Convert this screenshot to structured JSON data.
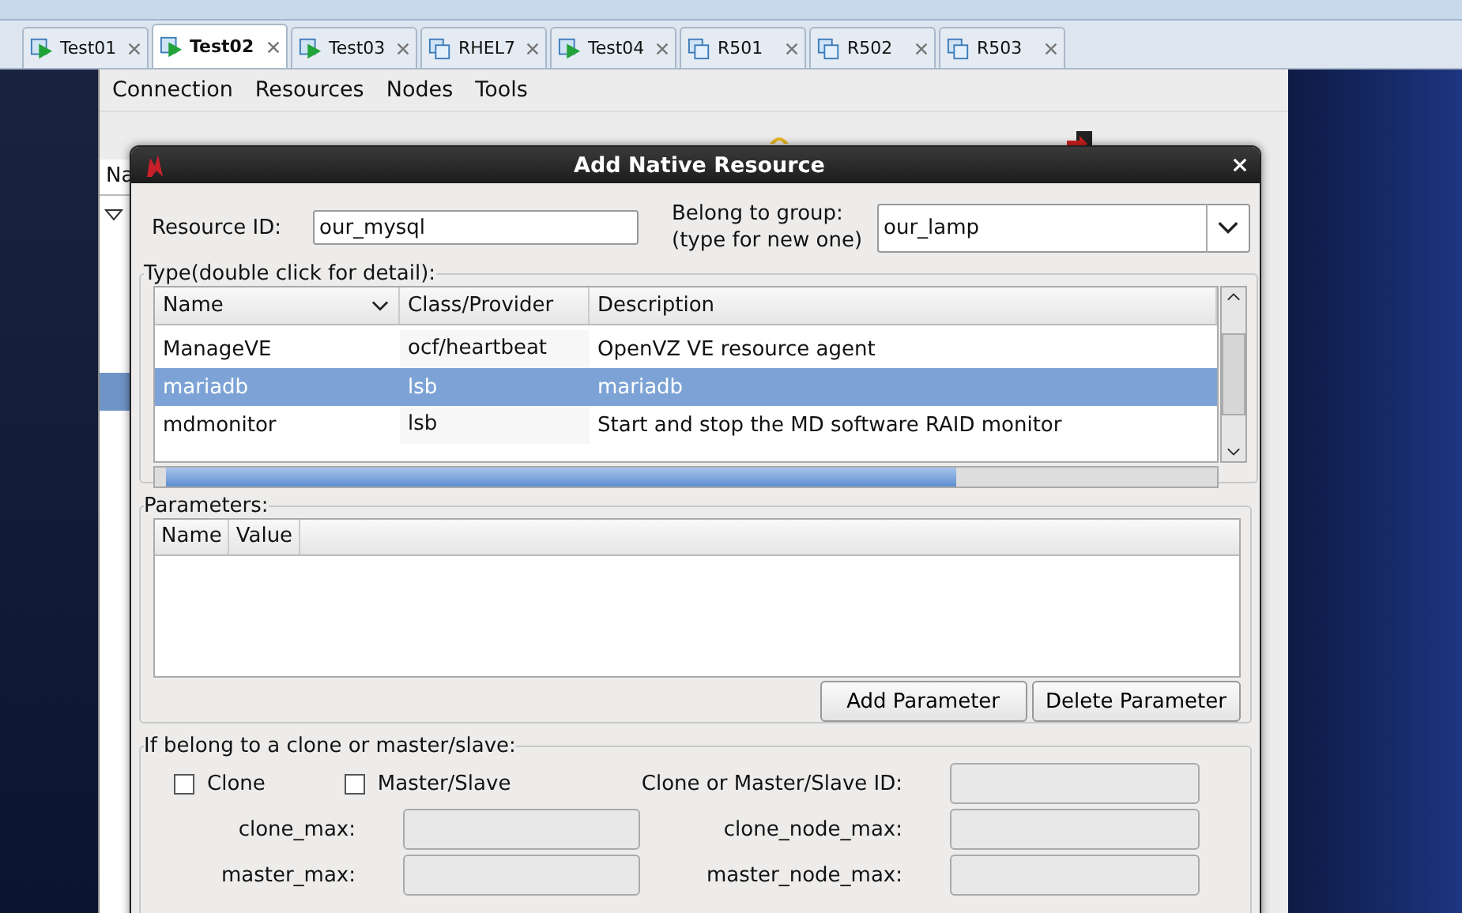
{
  "tabs": [
    {
      "label": "Test01",
      "kind": "running",
      "selected": false
    },
    {
      "label": "Test02",
      "kind": "running",
      "selected": true
    },
    {
      "label": "Test03",
      "kind": "running",
      "selected": false
    },
    {
      "label": "RHEL7",
      "kind": "stopped",
      "selected": false
    },
    {
      "label": "Test04",
      "kind": "running",
      "selected": false
    },
    {
      "label": "R501",
      "kind": "stopped",
      "selected": false
    },
    {
      "label": "R502",
      "kind": "stopped",
      "selected": false
    },
    {
      "label": "R503",
      "kind": "stopped",
      "selected": false
    }
  ],
  "menu": [
    "Connection",
    "Resources",
    "Nodes",
    "Tools"
  ],
  "tree_header": "Na",
  "dialog": {
    "title": "Add Native Resource",
    "resource_id": {
      "label": "Resource ID:",
      "value": "our_mysql"
    },
    "group": {
      "label_1": "Belong to group:",
      "label_2": "(type for new one)",
      "value": "our_lamp"
    },
    "type_section": {
      "title": "Type(double click for detail):",
      "columns": [
        "Name",
        "Class/Provider",
        "Description"
      ],
      "rows": [
        {
          "name": "ManageVE",
          "provider": "ocf/heartbeat",
          "description": "OpenVZ VE resource agent",
          "selected": false
        },
        {
          "name": "mariadb",
          "provider": "lsb",
          "description": "mariadb",
          "selected": true
        },
        {
          "name": "mdmonitor",
          "provider": "lsb",
          "description": "Start and stop the MD software RAID monitor",
          "selected": false
        }
      ]
    },
    "parameters": {
      "title": "Parameters:",
      "columns": [
        "Name",
        "Value"
      ],
      "buttons": [
        "Add Parameter",
        "Delete Parameter"
      ]
    },
    "clone": {
      "title": "If belong to a clone or master/slave:",
      "checkboxes": [
        {
          "label": "Clone",
          "checked": false
        },
        {
          "label": "Master/Slave",
          "checked": false
        }
      ],
      "id_field": {
        "label": "Clone or Master/Slave ID:",
        "disabled": true
      },
      "fields": [
        {
          "label": "clone_max:",
          "disabled": true
        },
        {
          "label": "clone_node_max:",
          "disabled": true
        },
        {
          "label": "master_max:",
          "disabled": true
        },
        {
          "label": "master_node_max:",
          "disabled": true
        }
      ]
    }
  }
}
